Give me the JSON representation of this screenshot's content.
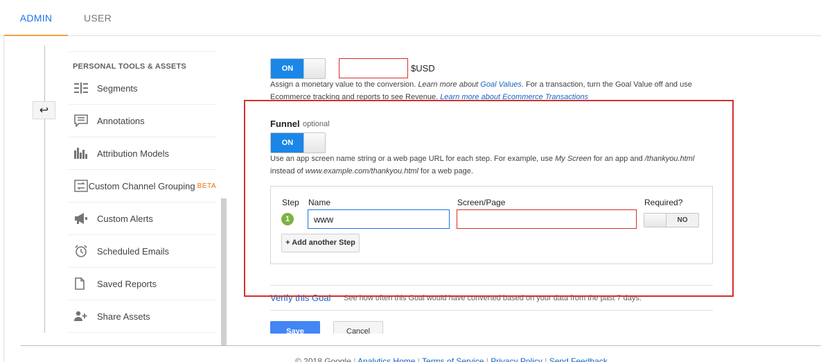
{
  "tabs": {
    "admin": "ADMIN",
    "user": "USER"
  },
  "sidebar": {
    "section_title": "PERSONAL TOOLS & ASSETS",
    "items": [
      {
        "label": "Segments",
        "icon": "segments-icon"
      },
      {
        "label": "Annotations",
        "icon": "annotations-icon"
      },
      {
        "label": "Attribution Models",
        "icon": "attribution-models-icon"
      },
      {
        "label": "Custom Channel Grouping",
        "badge": "BETA",
        "icon": "custom-channel-grouping-icon"
      },
      {
        "label": "Custom Alerts",
        "icon": "megaphone-icon"
      },
      {
        "label": "Scheduled Emails",
        "icon": "alarm-clock-icon"
      },
      {
        "label": "Saved Reports",
        "icon": "document-icon"
      },
      {
        "label": "Share Assets",
        "icon": "person-add-icon"
      }
    ]
  },
  "value": {
    "toggle_label": "ON",
    "currency": "$USD",
    "help_text_1": "Assign a monetary value to the conversion. ",
    "help_link_1": "Learn more about ",
    "help_link_1b": "Goal Values",
    "help_text_2": ". For a transaction, turn the Goal Value off and use Ecommerce tracking and reports to see Revenue. ",
    "help_link_2": "Learn more about Ecommerce Transactions"
  },
  "funnel": {
    "title": "Funnel",
    "optional": "optional",
    "toggle_label": "ON",
    "help_a": "Use an app screen name string or a web page URL for each step. For example, use ",
    "help_b": "My Screen",
    "help_c": " for an app and ",
    "help_d": "/thankyou.html",
    "help_e": "instead of ",
    "help_f": "www.example.com/thankyou.html",
    "help_g": " for a web page.",
    "columns": {
      "step": "Step",
      "name": "Name",
      "screen": "Screen/Page",
      "required": "Required?"
    },
    "steps": [
      {
        "number": "1",
        "name": "www",
        "screen": "",
        "required": "NO"
      }
    ],
    "add_step": "+ Add another Step"
  },
  "verify": {
    "link": "Verify this Goal",
    "description": "See how often this Goal would have converted based on your data from the past 7 days."
  },
  "actions": {
    "save": "Save",
    "cancel": "Cancel"
  },
  "footer": {
    "copyright": "© 2018 Google",
    "links": [
      "Analytics Home",
      "Terms of Service",
      "Privacy Policy",
      "Send Feedback"
    ]
  },
  "colors": {
    "accent": "#1a87e8",
    "highlight": "#d32f2f",
    "tab_underline": "#f4a142"
  }
}
